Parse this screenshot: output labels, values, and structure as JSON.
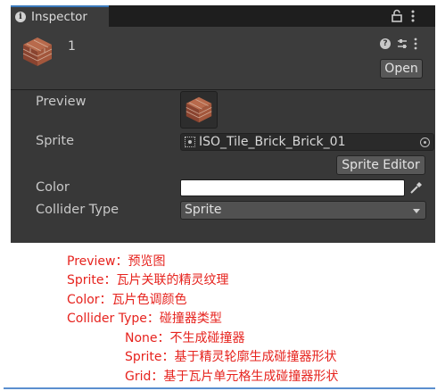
{
  "inspector": {
    "tab_title": "Inspector",
    "object_name": "1",
    "open_button": "Open",
    "fields": {
      "preview_label": "Preview",
      "sprite_label": "Sprite",
      "sprite_value": "ISO_Tile_Brick_Brick_01",
      "sprite_editor_button": "Sprite Editor",
      "color_label": "Color",
      "color_value": "#ffffff",
      "collider_type_label": "Collider Type",
      "collider_type_value": "Sprite"
    },
    "icons": [
      "info-icon",
      "lock-icon",
      "menu-icon",
      "help-icon",
      "preset-icon",
      "more-icon",
      "object-picker-icon",
      "eyedropper-icon",
      "dropdown-caret-icon",
      "brick-tile-icon"
    ]
  },
  "notes": {
    "preview": "Preview：预览图",
    "sprite": "Sprite：瓦片关联的精灵纹理",
    "color": "Color：瓦片色调颜色",
    "collider_type": "Collider Type：碰撞器类型",
    "none_option": "None：不生成碰撞器",
    "sprite_option": "Sprite：基于精灵轮廓生成碰撞器形状",
    "grid_option": "Grid：基于瓦片单元格生成碰撞器形状"
  },
  "colors": {
    "panel_bg": "#383838",
    "header_bg": "#3c3c3c",
    "tab_accent": "#3a79bb",
    "note_text": "#e6231e",
    "bottom_rule": "#5b8fcf"
  }
}
